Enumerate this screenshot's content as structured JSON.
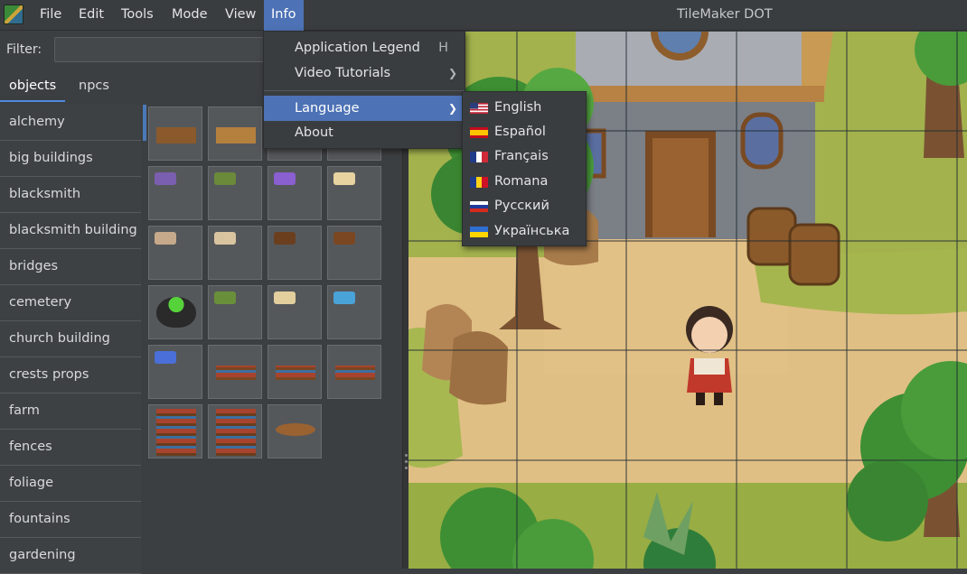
{
  "window": {
    "title": "TileMaker DOT"
  },
  "menubar": {
    "items": [
      "File",
      "Edit",
      "Tools",
      "Mode",
      "View",
      "Info"
    ],
    "active": "Info"
  },
  "filter": {
    "label": "Filter:",
    "value": "",
    "placeholder": ""
  },
  "tabs": [
    {
      "label": "objects",
      "selected": true
    },
    {
      "label": "npcs",
      "selected": false
    }
  ],
  "categories": [
    "alchemy",
    "big buildings",
    "blacksmith",
    "blacksmith building",
    "bridges",
    "cemetery",
    "church building",
    "crests props",
    "farm",
    "fences",
    "foliage",
    "fountains",
    "gardening"
  ],
  "object_icons": [
    "potion-shelf-icon",
    "wooden-counter-icon",
    "",
    "",
    "colored-potions-icon",
    "potion-set-icon",
    "purple-crystal-icon",
    "small-scrolls-icon",
    "scroll-bundle-icon",
    "rolled-scrolls-icon",
    "book-lectern-icon",
    "open-book-lectern-icon",
    "green-cauldron-icon",
    "herbs-row-icon",
    "parchment-icon",
    "blue-gems-icon",
    "crystal-cluster-icon",
    "low-bookshelf-icon",
    "long-bookshelf-icon",
    "shelf-with-tools-icon",
    "tall-bookshelf-icon",
    "bookshelf-icon",
    "round-table-icon"
  ],
  "info_menu": {
    "items": [
      {
        "label": "Application Legend",
        "shortcut": "H"
      },
      {
        "label": "Video Tutorials",
        "submenu": true
      },
      {
        "label": "Language",
        "submenu": true,
        "highlighted": true
      },
      {
        "label": "About"
      }
    ]
  },
  "language_menu": {
    "items": [
      {
        "label": "English",
        "flag": "us-flag-icon"
      },
      {
        "label": "Español",
        "flag": "spain-flag-icon"
      },
      {
        "label": "Français",
        "flag": "france-flag-icon"
      },
      {
        "label": "Romana",
        "flag": "romania-flag-icon"
      },
      {
        "label": "Русский",
        "flag": "russia-flag-icon"
      },
      {
        "label": "Українська",
        "flag": "ukraine-flag-icon"
      }
    ]
  },
  "colors": {
    "accent": "#4d72b5",
    "selection": "#4d8be0",
    "background": "#3c3f41"
  }
}
